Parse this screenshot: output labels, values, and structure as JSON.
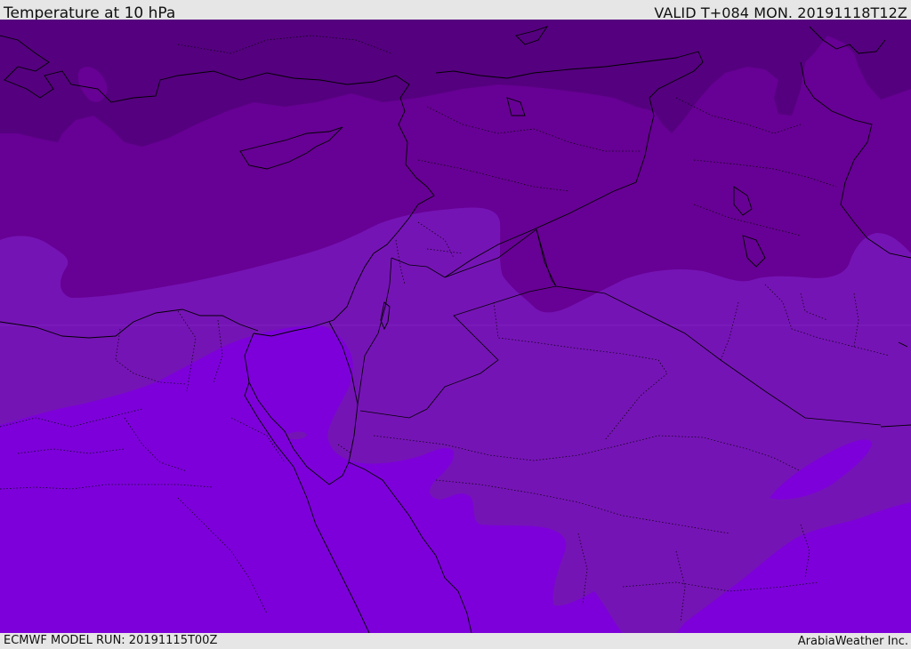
{
  "header": {
    "title": "Temperature at 10 hPa",
    "valid_time": "VALID T+084 MON. 20191118T12Z"
  },
  "footer": {
    "model_run": "ECMWF MODEL RUN: 20191115T00Z",
    "credit": "ArabiaWeather Inc."
  },
  "map": {
    "colors": {
      "coldest_band": "#55007f",
      "cold_band": "#670094",
      "mid_band": "#7514b5",
      "warm_band": "#7d00da",
      "border_line": "#000000"
    }
  }
}
